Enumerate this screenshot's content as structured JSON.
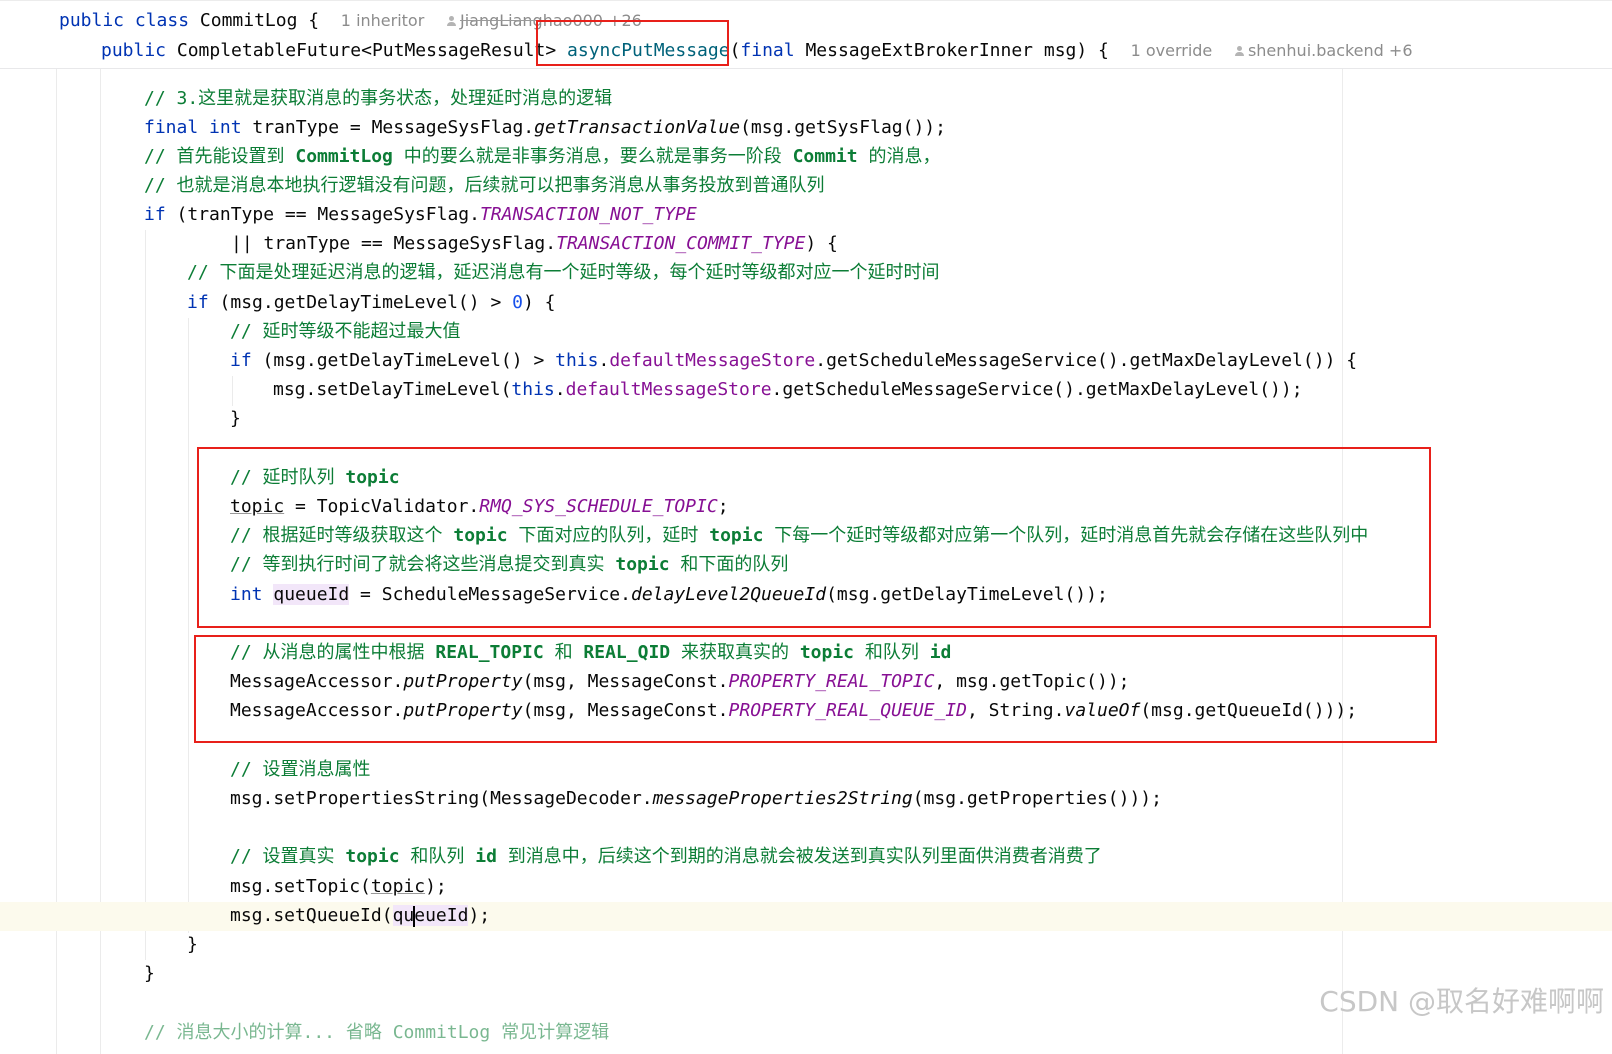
{
  "sticky_header": {
    "class_line": {
      "decl": "public class",
      "name": "CommitLog {",
      "inheritors": "1 inheritor",
      "author": "JiangLianghao000 +26"
    },
    "method_line": {
      "mod": "public",
      "ret": "CompletableFuture<PutMessageResult>",
      "name": "asyncPutMessage",
      "paren": "(",
      "final_kw": "final",
      "params": " MessageExtBrokerInner msg) {",
      "overrides": "1 override",
      "author": "shenhui.backend +6"
    }
  },
  "code": {
    "l1": {
      "comment": "// 3.这里就是获取消息的事务状态，处理延时消息的逻辑"
    },
    "l2": {
      "kw1": "final",
      "kw2": "int",
      "t1": " tranType = MessageSysFlag.",
      "call": "getTransactionValue",
      "t2": "(msg.getSysFlag());"
    },
    "l3": {
      "c1": "// 首先能设置到 ",
      "b1": "CommitLog",
      "c2": " 中的要么就是非事务消息，要么就是事务一阶段 ",
      "b2": "Commit",
      "c3": " 的消息，"
    },
    "l4": {
      "comment": "// 也就是消息本地执行逻辑没有问题，后续就可以把事务消息从事务投放到普通队列"
    },
    "l5": {
      "kw": "if",
      "t1": " (tranType == MessageSysFlag.",
      "const": "TRANSACTION_NOT_TYPE"
    },
    "l6": {
      "t1": "|| tranType == MessageSysFlag.",
      "const": "TRANSACTION_COMMIT_TYPE",
      "t2": ") {"
    },
    "l7": {
      "comment": "// 下面是处理延迟消息的逻辑，延迟消息有一个延时等级，每个延时等级都对应一个延时时间"
    },
    "l8": {
      "kw": "if",
      "t1": " (msg.getDelayTimeLevel() > ",
      "num": "0",
      "t2": ") {"
    },
    "l9": {
      "comment": "// 延时等级不能超过最大值"
    },
    "l10": {
      "kw": "if",
      "t1": " (msg.getDelayTimeLevel() > ",
      "this": "this",
      "dot": ".",
      "field": "defaultMessageStore",
      "t2": ".getScheduleMessageService().getMaxDelayLevel()) {"
    },
    "l11": {
      "t1": "msg.setDelayTimeLevel(",
      "this": "this",
      "dot": ".",
      "field": "defaultMessageStore",
      "t2": ".getScheduleMessageService().getMaxDelayLevel());"
    },
    "l12": {
      "t1": "}"
    },
    "l13": {
      "c1": "// 延时队列 ",
      "b1": "topic"
    },
    "l14": {
      "var": "topic",
      "t1": " = TopicValidator.",
      "const": "RMQ_SYS_SCHEDULE_TOPIC",
      "t2": ";"
    },
    "l15": {
      "c1": "// 根据延时等级获取这个 ",
      "b1": "topic",
      "c2": " 下面对应的队列，延时 ",
      "b2": "topic",
      "c3": " 下每一个延时等级都对应第一个队列，延时消息首先就会存储在这些队列中"
    },
    "l16": {
      "c1": "// 等到执行时间了就会将这些消息提交到真实 ",
      "b1": "topic",
      "c2": " 和下面的队列"
    },
    "l17": {
      "kw": "int",
      "var": "queueId",
      "t1": " = ScheduleMessageService.",
      "call": "delayLevel2QueueId",
      "t2": "(msg.getDelayTimeLevel());"
    },
    "l18": {
      "c1": "// 从消息的属性中根据 ",
      "b1": "REAL_TOPIC",
      "c2": " 和 ",
      "b2": "REAL_QID",
      "c3": " 来获取真实的 ",
      "b3": "topic",
      "c4": " 和队列 ",
      "b4": "id"
    },
    "l19": {
      "t1": "MessageAccessor.",
      "call": "putProperty",
      "t2": "(msg, MessageConst.",
      "const": "PROPERTY_REAL_TOPIC",
      "t3": ", msg.getTopic());"
    },
    "l20": {
      "t1": "MessageAccessor.",
      "call": "putProperty",
      "t2": "(msg, MessageConst.",
      "const": "PROPERTY_REAL_QUEUE_ID",
      "t3": ", String.",
      "call2": "valueOf",
      "t4": "(msg.getQueueId()));"
    },
    "l21": {
      "comment": "// 设置消息属性"
    },
    "l22": {
      "t1": "msg.setPropertiesString(MessageDecoder.",
      "call": "messageProperties2String",
      "t2": "(msg.getProperties()));"
    },
    "l23": {
      "c1": "// 设置真实 ",
      "b1": "topic",
      "c2": " 和队列 ",
      "b2": "id",
      "c3": " 到消息中，后续这个到期的消息就会被发送到真实队列里面供消费者消费了"
    },
    "l24": {
      "t1": "msg.setTopic(",
      "var": "topic",
      "t2": ");"
    },
    "l25": {
      "t1": "msg.setQueueId(",
      "var_a": "qu",
      "var_b": "eueId",
      "t2": ");"
    },
    "l26": {
      "t1": "}"
    },
    "l27": {
      "t1": "}"
    },
    "l28": {
      "comment": "// 消息大小的计算... 省略 CommitLog 常见计算逻辑"
    }
  },
  "watermark": "CSDN @取名好难啊啊"
}
